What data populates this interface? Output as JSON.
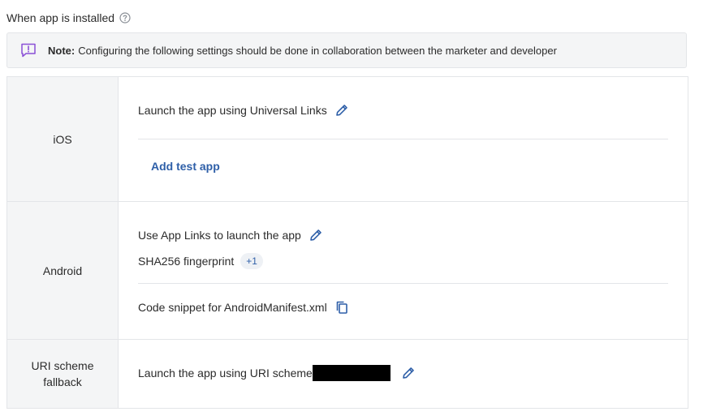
{
  "section": {
    "title": "When app is installed"
  },
  "note": {
    "label": "Note:",
    "text": "Configuring the following settings should be done in collaboration between the marketer and developer"
  },
  "rows": {
    "ios": {
      "label": "iOS",
      "launch_text": "Launch the app using Universal Links",
      "add_test_app": "Add test app"
    },
    "android": {
      "label": "Android",
      "launch_text": "Use App Links to launch the app",
      "fingerprint_label": "SHA256 fingerprint",
      "fingerprint_badge": "+1",
      "snippet_text": "Code snippet for AndroidManifest.xml"
    },
    "uri": {
      "label_line1": "URI scheme",
      "label_line2": "fallback",
      "launch_text": "Launch the app using URI scheme"
    }
  },
  "icons": {
    "help": "question-circle-icon",
    "note": "message-exclamation-icon",
    "edit": "pencil-icon",
    "copy": "copy-icon"
  },
  "colors": {
    "accent": "#2e5fa8",
    "note_icon": "#8a4fd6",
    "panel_bg": "#f4f5f6",
    "border": "#e3e5e8"
  }
}
